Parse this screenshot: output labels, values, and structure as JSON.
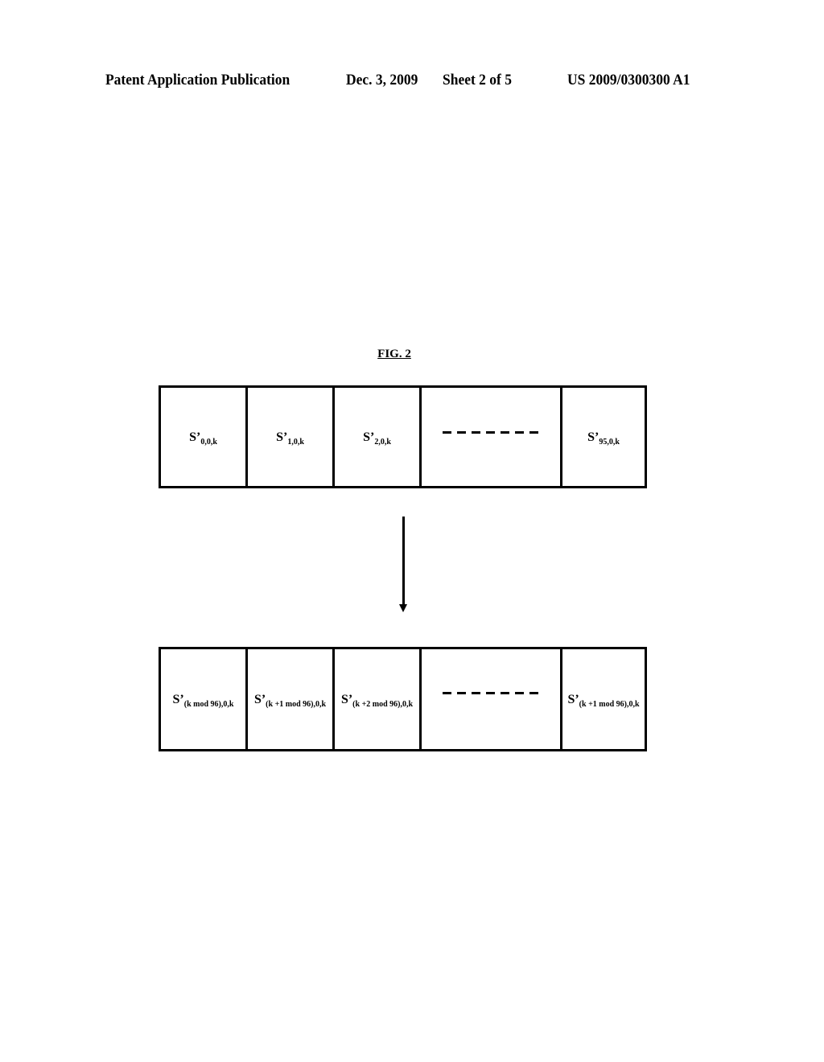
{
  "header": {
    "publication": "Patent Application Publication",
    "date": "Dec. 3, 2009",
    "sheet": "Sheet 2 of 5",
    "number": "US 2009/0300300 A1"
  },
  "figure": {
    "title": "FIG. 2",
    "top_row": [
      {
        "base": "S’",
        "sub": "0,0,k"
      },
      {
        "base": "S’",
        "sub": "1,0,k"
      },
      {
        "base": "S’",
        "sub": "2,0,k"
      },
      {
        "ellipsis": "dashes"
      },
      {
        "base": "S’",
        "sub": "95,0,k"
      }
    ],
    "arrow": "down-arrow",
    "bottom_row": [
      {
        "base": "S’",
        "sub": "(k mod 96),0,k"
      },
      {
        "base": "S’",
        "sub": "(k +1 mod 96),0,k"
      },
      {
        "base": "S’",
        "sub": "(k +2 mod 96),0,k"
      },
      {
        "ellipsis": "dashes"
      },
      {
        "base": "S’",
        "sub": "(k +1 mod 96),0,k"
      }
    ]
  }
}
